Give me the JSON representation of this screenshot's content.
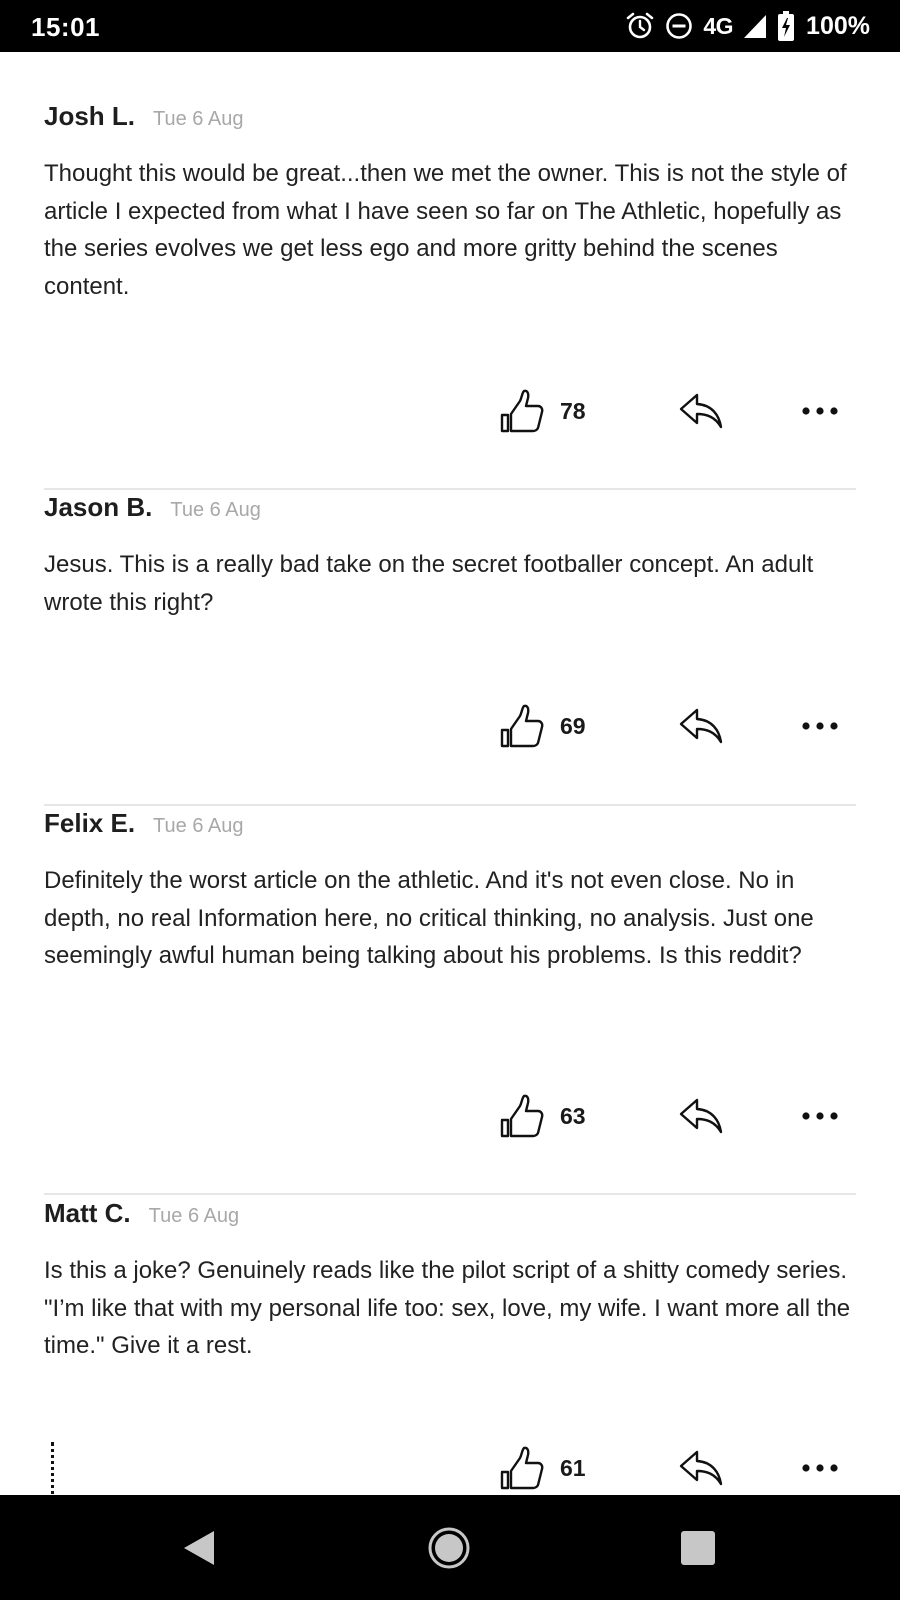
{
  "status": {
    "time": "15:01",
    "network": "4G",
    "battery": "100%",
    "icons": [
      "alarm-icon",
      "do-not-disturb-icon",
      "signal-icon",
      "battery-charging-icon"
    ]
  },
  "comments": [
    {
      "author": "Josh L.",
      "date": "Tue 6 Aug",
      "body": "Thought this would be great...then we met the owner. This is not the style of article I expected from what I have seen so far on The Athletic, hopefully as the series evolves we get less ego and more gritty behind the scenes content.",
      "likes": "78"
    },
    {
      "author": "Jason B.",
      "date": "Tue 6 Aug",
      "body": "Jesus. This is a really bad take on the secret footballer concept. An adult wrote this right?",
      "likes": "69"
    },
    {
      "author": "Felix E.",
      "date": "Tue 6 Aug",
      "body": "Definitely the worst article on the athletic. And it's not even close. No in depth, no real Information here, no critical thinking, no analysis. Just one seemingly awful human being talking about his problems. Is this reddit?",
      "likes": "63"
    },
    {
      "author": "Matt C.",
      "date": "Tue 6 Aug",
      "body": "Is this a joke? Genuinely reads like the pilot script of a shitty comedy series.  \"I’m like that with my personal life too: sex, love, my wife. I want more all the time.\" Give it a rest.",
      "likes": "61"
    }
  ],
  "navigation": {
    "icons": [
      "back-icon",
      "home-icon",
      "recents-icon"
    ]
  }
}
